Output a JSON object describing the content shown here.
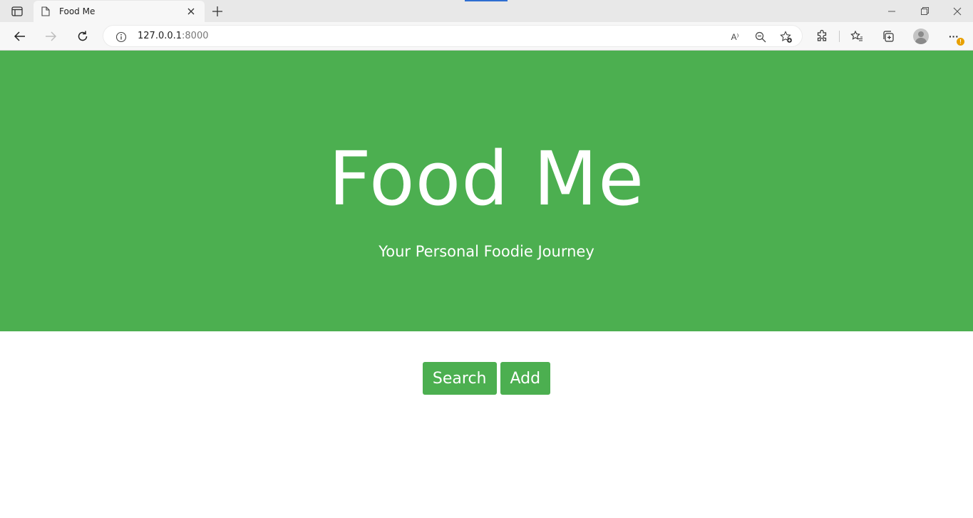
{
  "browser": {
    "tab_title": "Food Me",
    "url_host": "127.0.0.1",
    "url_port": ":8000",
    "icons": [
      "sidebar-icon",
      "page-icon",
      "close-icon",
      "plus-icon",
      "minimize-icon",
      "restore-icon",
      "close-window-icon",
      "back-icon",
      "forward-icon",
      "refresh-icon",
      "info-icon",
      "read-aloud-icon",
      "zoom-out-icon",
      "add-favorite-icon",
      "extensions-icon",
      "favorites-icon",
      "collections-icon",
      "profile-icon",
      "more-icon"
    ],
    "read_aloud_label": "A⁾",
    "more_label": "···",
    "notification_count": "!"
  },
  "hero": {
    "title": "Food Me",
    "subtitle": "Your Personal Foodie Journey",
    "background": "#4caf50"
  },
  "actions": {
    "search_label": "Search",
    "add_label": "Add"
  }
}
